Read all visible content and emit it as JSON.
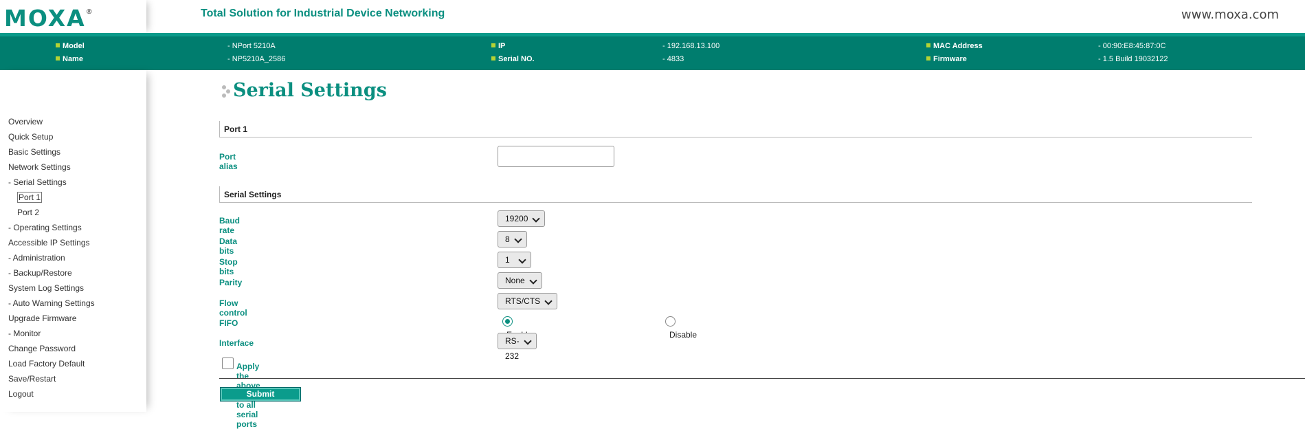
{
  "header": {
    "logo_text": "MOXA",
    "logo_mark": "®",
    "tagline": "Total Solution for Industrial Device Networking",
    "site": "www.moxa.com"
  },
  "infobar": {
    "model_label": "Model",
    "model_value": "- NPort 5210A",
    "name_label": "Name",
    "name_value": "- NP5210A_2586",
    "ip_label": "IP",
    "ip_value": "- 192.168.13.100",
    "serial_label": "Serial NO.",
    "serial_value": "- 4833",
    "mac_label": "MAC Address",
    "mac_value": "- 00:90:E8:45:87:0C",
    "firmware_label": "Firmware",
    "firmware_value": "- 1.5 Build 19032122"
  },
  "sidebar": {
    "items": [
      "Overview",
      "Quick Setup",
      "Basic Settings",
      "Network Settings",
      "- Serial Settings",
      "Port 1",
      "Port 2",
      "- Operating Settings",
      "Accessible IP Settings",
      "- Administration",
      "- Backup/Restore",
      "System Log Settings",
      "- Auto Warning Settings",
      "Upgrade Firmware",
      "- Monitor",
      "Change Password",
      "Load Factory Default",
      "Save/Restart",
      "Logout"
    ]
  },
  "main": {
    "title": "Serial Settings",
    "port_section": "Port 1",
    "port_alias_label": "Port alias",
    "port_alias_value": "",
    "serial_section": "Serial Settings",
    "baud_label": "Baud rate",
    "baud_value": "19200",
    "databits_label": "Data bits",
    "databits_value": "8",
    "stopbits_label": "Stop bits",
    "stopbits_value": "1",
    "parity_label": "Parity",
    "parity_value": "None",
    "flow_label": "Flow control",
    "flow_value": "RTS/CTS",
    "fifo_label": "FIFO",
    "fifo_enable": "Enable",
    "fifo_disable": "Disable",
    "fifo_selected": "Enable",
    "interface_label": "Interface",
    "interface_value": "RS-232",
    "apply_all_label": "Apply the above settings to all serial ports",
    "apply_all_checked": false,
    "submit_label": "Submit"
  },
  "colors": {
    "brand": "#0b8f80",
    "infobar": "#007d6e",
    "bullet": "#b5d334"
  }
}
